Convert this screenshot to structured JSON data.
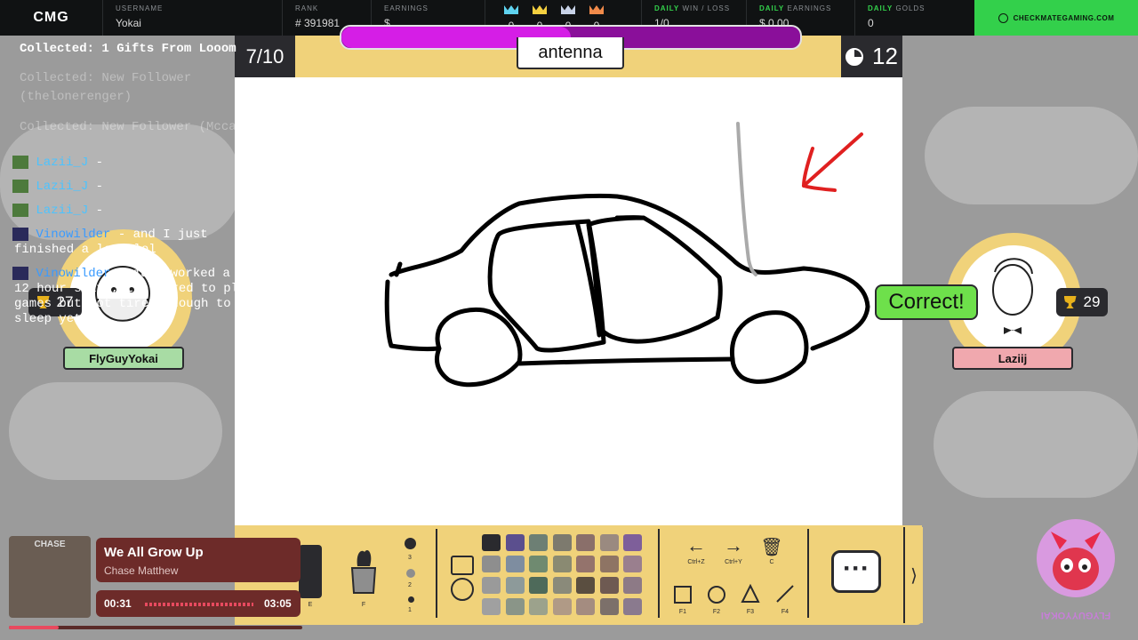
{
  "topbar": {
    "logo": "CMG",
    "username_label": "USERNAME",
    "username": "Yokai",
    "rank_label": "RANK",
    "rank": "# 391981",
    "earnings_label": "EARNINGS",
    "earnings": "$",
    "crowns": [
      {
        "color": "#5fd3f0",
        "value": "0"
      },
      {
        "color": "#f5d040",
        "value": "0"
      },
      {
        "color": "#c8d3e8",
        "value": "0"
      },
      {
        "color": "#f08a4a",
        "value": "0"
      }
    ],
    "daily_winloss_prefix": "DAILY",
    "daily_winloss_label": "WIN / LOSS",
    "daily_winloss": "1/0",
    "daily_earnings_prefix": "DAILY",
    "daily_earnings_label": "EARNINGS",
    "daily_earnings": "$ 0.00",
    "daily_golds_prefix": "DAILY",
    "daily_golds_label": "GOLDS",
    "daily_golds": "0",
    "cta": "CHECKMATEGAMING.COM"
  },
  "game": {
    "round": "7/10",
    "word": "antenna",
    "timer": "12",
    "timer_progress": 0.5
  },
  "players": {
    "left": {
      "name": "FlyGuyYokai",
      "score": "27"
    },
    "right": {
      "name": "Laziij",
      "score": "29",
      "status": "Correct!"
    }
  },
  "toolbar": {
    "fill_label": "E",
    "bucket_label": "F",
    "sizes": [
      "3",
      "2",
      "1"
    ],
    "undo_label": "Ctrl+Z",
    "redo_label": "Ctrl+Y",
    "clear_label": "C",
    "shape_labels": [
      "F1",
      "F2",
      "F3",
      "F4"
    ],
    "colors": [
      "#2a2a2e",
      "#5b4f8e",
      "#6d7f74",
      "#7d7a6e",
      "#8a6f6a",
      "#9a8a80",
      "#7e5f9a",
      "#8e8e8e",
      "#7e8da0",
      "#6f8a70",
      "#8a8a72",
      "#94736c",
      "#8e7464",
      "#9a7f8e",
      "#9a9a9a",
      "#8d9a9a",
      "#4e6a5a",
      "#8a8a7a",
      "#5a4e40",
      "#6e5a52",
      "#8d7a86",
      "#a0a0a0",
      "#8a9588",
      "#9ca28c",
      "#b09a86",
      "#a48c80",
      "#7c706a",
      "#8a7a8e"
    ]
  },
  "chat": {
    "notifications": [
      {
        "text": "Collected: 1 Gifts From Looom"
      },
      {
        "text": "Collected: New Follower"
      },
      {
        "text": "(thelonerenger)"
      },
      {
        "text": "Collected: New Follower (Mccallan15)"
      }
    ],
    "messages": [
      {
        "user": "Lazii_J",
        "text": "-"
      },
      {
        "user": "Lazii_J",
        "text": "-"
      },
      {
        "user": "Lazii_J",
        "text": "-"
      },
      {
        "user": "Vinowilder",
        "text": "- and I just",
        "cont": "finished a long lol"
      },
      {
        "user": "Vinowilder",
        "text": "- just worked a",
        "cont1": "12 hour shift, too tired to play",
        "cont2": "games but not tired enough to go to",
        "cont3": "sleep yet"
      }
    ]
  },
  "music": {
    "album_text": "CHASE",
    "title": "We All Grow Up",
    "artist": "Chase Matthew",
    "elapsed": "00:31",
    "total": "03:05",
    "progress": 0.17
  },
  "mascot": {
    "text": "FLYGUYYOKAI"
  },
  "colors": {
    "accent_green": "#33d04b",
    "panel_yellow": "#f0d27a",
    "dark": "#2a2a2e",
    "correct_green": "#6ee04b",
    "pink_tag": "#f0a8ae",
    "green_tag": "#a8dca4",
    "purple_bar": "#d51ee6"
  }
}
